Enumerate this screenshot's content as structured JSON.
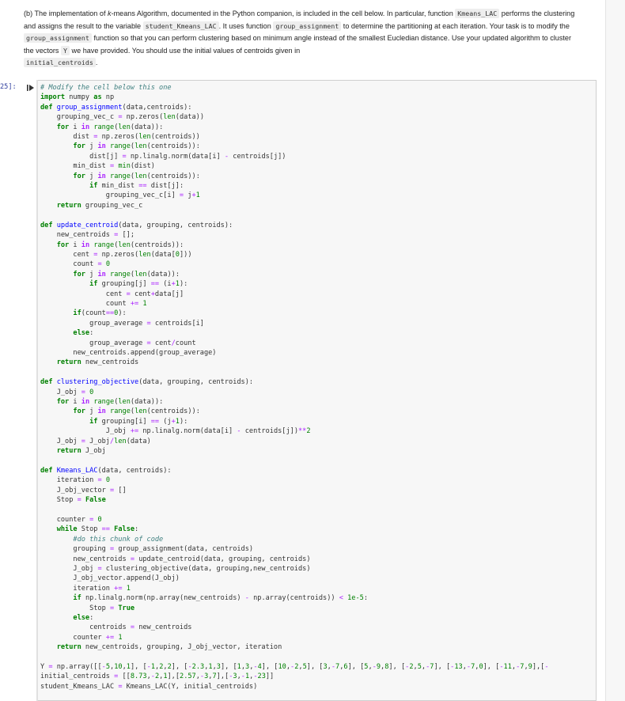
{
  "markdown": {
    "part_label": "(b)",
    "t1": "The implementation of ",
    "kmeans_name": "k",
    "t2": "-means Algorithm, documented in the Python companion, is included in the cell below. In particular, function ",
    "c1": "Kmeans_LAC",
    "t3": "performs the clustering and assigns the result to the variable ",
    "c2": "student_Kmeans_LAC",
    "t4": ". It uses function ",
    "c3": "group_assignment",
    "t5": " to determine the partitioning at each iteration. Your task is to modify the ",
    "c4": "group_assignment",
    "t6": " function so that you can perform clustering based on minimum angle instead of the smallest Eucledian distance. Use your updated algorithm to cluster the vectors ",
    "c5": "Y",
    "t7": " we have provided. You should use the initial values of centroids given in",
    "c6": "initial_centroids",
    "t8": "."
  },
  "cell": {
    "prompt": "25]:",
    "code_lines": [
      "# Modify the cell below this one",
      "import numpy as np",
      "def group_assignment(data,centroids):",
      "    grouping_vec_c = np.zeros(len(data))",
      "    for i in range(len(data)):",
      "        dist = np.zeros(len(centroids))",
      "        for j in range(len(centroids)):",
      "            dist[j] = np.linalg.norm(data[i] - centroids[j])",
      "        min_dist = min(dist)",
      "        for j in range(len(centroids)):",
      "            if min_dist == dist[j]:",
      "                grouping_vec_c[i] = j+1",
      "    return grouping_vec_c",
      "",
      "def update_centroid(data, grouping, centroids):",
      "    new_centroids = [];",
      "    for i in range(len(centroids)):",
      "        cent = np.zeros(len(data[0]))",
      "        count = 0",
      "        for j in range(len(data)):",
      "            if grouping[j] == (i+1):",
      "                cent = cent+data[j]",
      "                count += 1",
      "        if(count==0):",
      "            group_average = centroids[i]",
      "        else:",
      "            group_average = cent/count",
      "        new_centroids.append(group_average)",
      "    return new_centroids",
      "",
      "def clustering_objective(data, grouping, centroids):",
      "    J_obj = 0",
      "    for i in range(len(data)):",
      "        for j in range(len(centroids)):",
      "            if grouping[i] == (j+1):",
      "                J_obj += np.linalg.norm(data[i] - centroids[j])**2",
      "    J_obj = J_obj/len(data)",
      "    return J_obj",
      "",
      "def Kmeans_LAC(data, centroids):",
      "    iteration = 0",
      "    J_obj_vector = []",
      "    Stop = False",
      "",
      "    counter = 0",
      "    while Stop == False:",
      "        #do this chunk of code",
      "        grouping = group_assignment(data, centroids)",
      "        new_centroids = update_centroid(data, grouping, centroids)",
      "        J_obj = clustering_objective(data, grouping,new_centroids)",
      "        J_obj_vector.append(J_obj)",
      "        iteration += 1",
      "        if np.linalg.norm(np.array(new_centroids) - np.array(centroids)) < 1e-5:",
      "            Stop = True",
      "        else:",
      "            centroids = new_centroids",
      "        counter += 1",
      "    return new_centroids, grouping, J_obj_vector, iteration",
      "",
      "Y = np.array([[-5,10,1], [-1,2,2], [-2.3,1,3], [1,3,-4], [10,-2,5], [3,-7,6], [5,-9,8], [-2,5,-7], [-13,-7,0], [-11,-7,9],[-",
      "initial_centroids = [[8.73,-2,1],[2.57,-3,7],[-3,-1,-23]]",
      "student_Kmeans_LAC = Kmeans_LAC(Y, initial_centroids)"
    ]
  },
  "colors": {
    "keyword": "#008000",
    "function_name": "#0000ff",
    "comment": "#408080",
    "operator": "#aa22ff",
    "prompt": "#303f9f",
    "cell_bg": "#f7f7f7"
  },
  "icons": {
    "run": "skip-to-cursor-icon"
  }
}
